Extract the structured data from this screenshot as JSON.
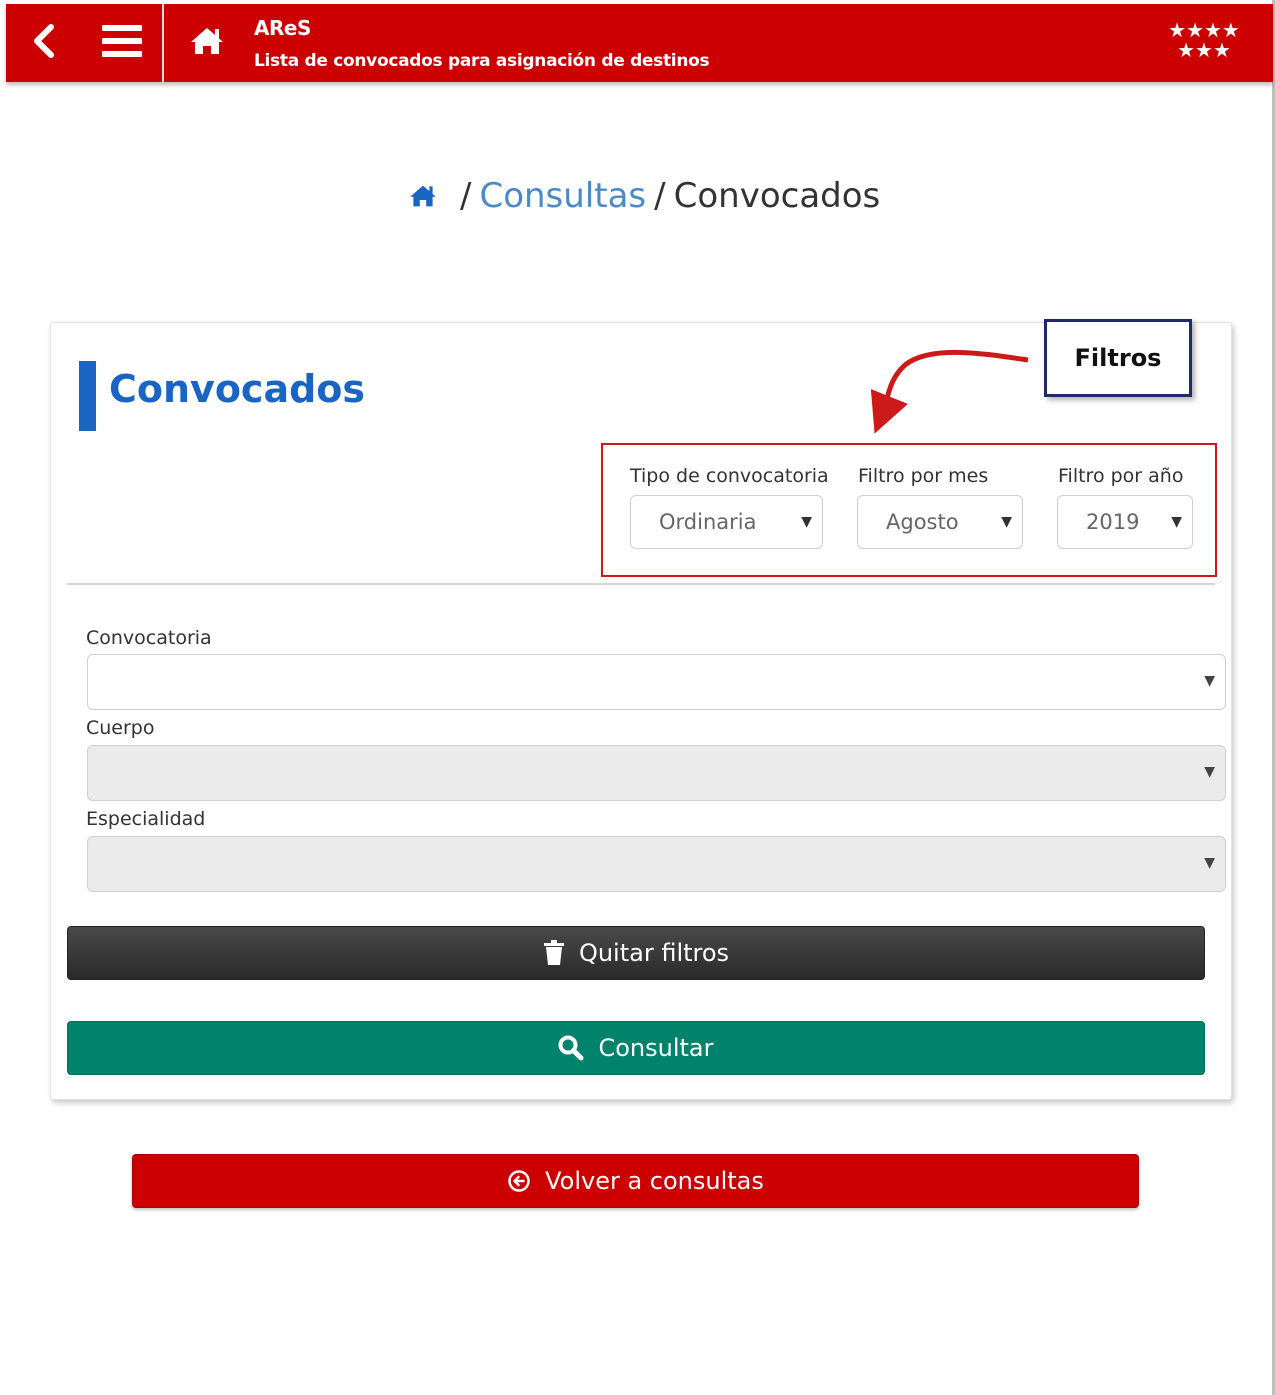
{
  "header": {
    "app_title": "AReS",
    "app_subtitle": "Lista de convocados para asignación de destinos",
    "back_icon": "chevron-left-icon",
    "menu_icon": "hamburger-menu-icon",
    "home_icon": "home-icon",
    "flag_icon": "madrid-stars-flag",
    "color": "#cc0000"
  },
  "breadcrumb": {
    "home_icon": "home-icon",
    "separator": "/",
    "link": "Consultas",
    "current": "Convocados"
  },
  "card": {
    "title": "Convocados",
    "accent_color": "#1a64c4"
  },
  "filters": {
    "tipo": {
      "label": "Tipo de convocatoria",
      "value": "Ordinaria"
    },
    "mes": {
      "label": "Filtro por mes",
      "value": "Agosto"
    },
    "anio": {
      "label": "Filtro por año",
      "value": "2019"
    }
  },
  "annotation": {
    "label": "Filtros",
    "color": "#cc1a1a"
  },
  "fields": {
    "convocatoria": {
      "label": "Convocatoria",
      "value": ""
    },
    "cuerpo": {
      "label": "Cuerpo",
      "value": ""
    },
    "especialidad": {
      "label": "Especialidad",
      "value": ""
    }
  },
  "buttons": {
    "clear": {
      "label": "Quitar filtros",
      "icon": "trash-icon"
    },
    "search": {
      "label": "Consultar",
      "icon": "search-icon",
      "color": "#00826b"
    },
    "back": {
      "label": "Volver a consultas",
      "icon": "circle-arrow-left-icon",
      "color": "#cc0000"
    }
  }
}
